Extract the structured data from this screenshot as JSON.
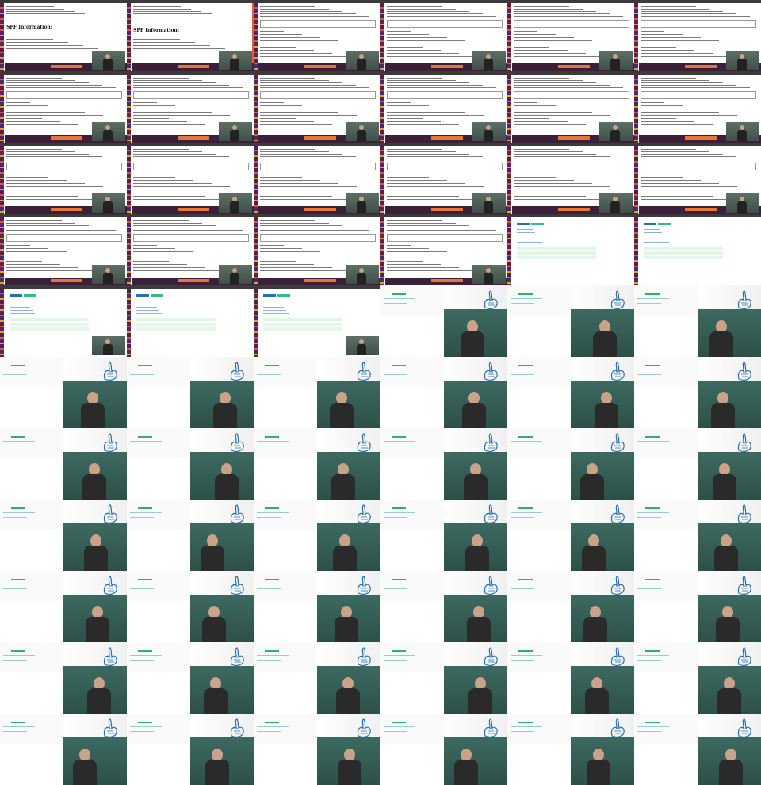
{
  "sheet": {
    "columns": 6,
    "rows": 11,
    "tile_kinds": [
      "terminal-title",
      "terminal-title",
      "terminal-output",
      "terminal-output",
      "terminal-output",
      "terminal-output",
      "terminal-output",
      "terminal-output",
      "terminal-output",
      "terminal-output",
      "terminal-output",
      "terminal-output",
      "terminal-output",
      "terminal-output",
      "terminal-output",
      "terminal-output",
      "terminal-output",
      "terminal-output",
      "terminal-output",
      "terminal-output",
      "terminal-output",
      "terminal-output",
      "web-page",
      "web-page",
      "web-page-cam",
      "web-page",
      "web-page-cam",
      "lecture",
      "lecture",
      "lecture",
      "lecture",
      "lecture",
      "lecture",
      "lecture",
      "lecture",
      "lecture",
      "lecture",
      "lecture",
      "lecture",
      "lecture",
      "lecture",
      "lecture",
      "lecture",
      "lecture",
      "lecture",
      "lecture",
      "lecture",
      "lecture",
      "lecture",
      "lecture",
      "lecture",
      "lecture",
      "lecture",
      "lecture",
      "lecture",
      "lecture",
      "lecture",
      "lecture",
      "lecture",
      "lecture",
      "lecture",
      "lecture",
      "lecture",
      "lecture",
      "lecture",
      "lecture"
    ]
  },
  "slide_headings": {
    "spf_information": "SPF Information:",
    "dns_lookup": "SPF Record Lookup"
  },
  "colors": {
    "dock": "#5a1e4a",
    "footer": "#3c1f38",
    "accent_orange": "#e9743a",
    "board_green": "#3d6a60",
    "logo_blue": "#2a6fb0",
    "pill_green": "#30c080"
  },
  "icons": {
    "logo": "rabbit-logo-icon"
  }
}
